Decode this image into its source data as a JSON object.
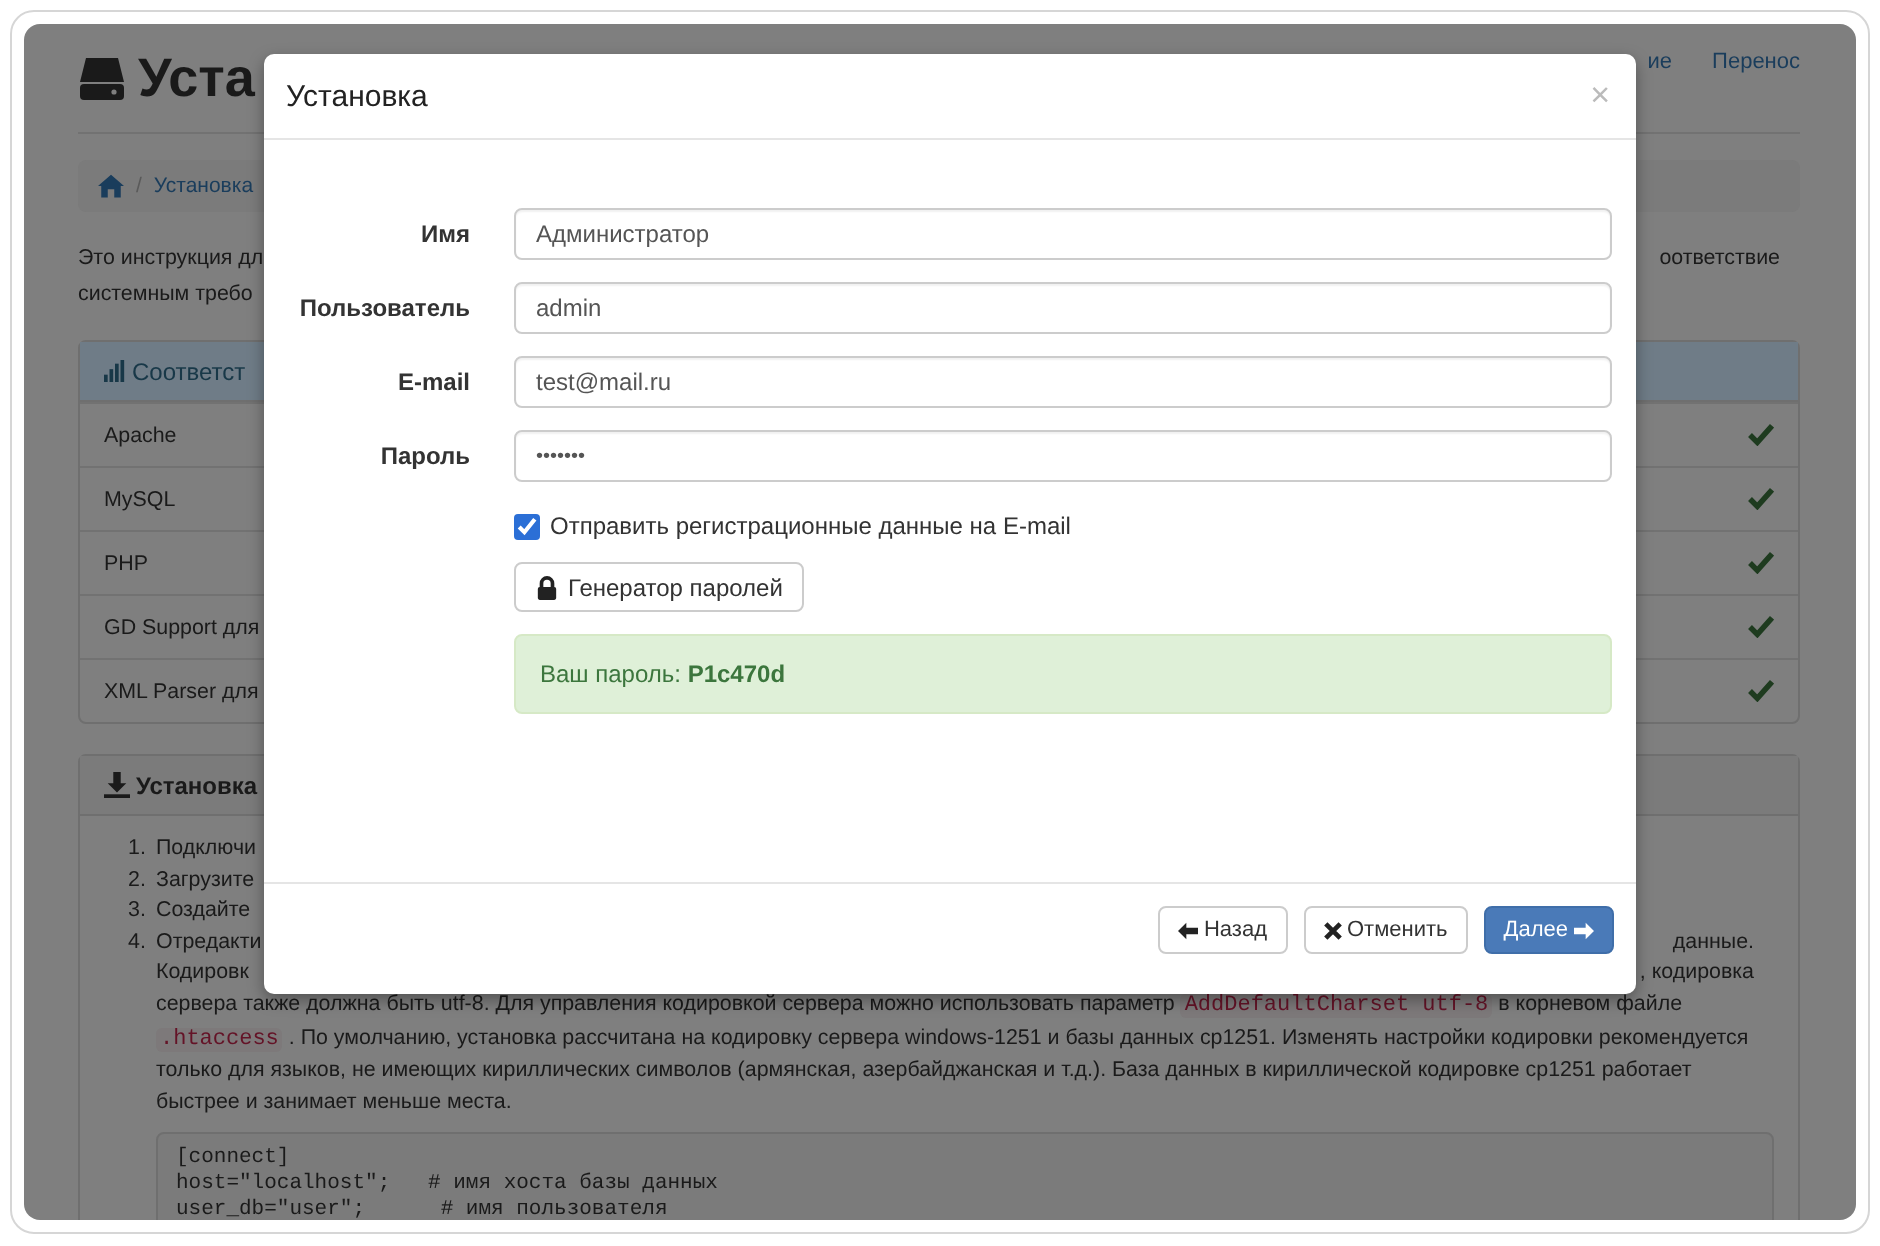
{
  "header": {
    "title": "Уста",
    "nav": [
      "ие",
      "Перенос"
    ]
  },
  "breadcrumb": {
    "separator": "/",
    "items": [
      "Установка"
    ]
  },
  "intro": {
    "lines": [
      {
        "left": "Это инструкция дл",
        "right": "оответствие"
      },
      {
        "left": "системным требо"
      }
    ]
  },
  "requirements": {
    "title": "Соответст",
    "rows": [
      {
        "name": "Apache",
        "ok": true
      },
      {
        "name": "MySQL",
        "ok": true
      },
      {
        "name": "PHP",
        "ok": true
      },
      {
        "name": "GD Support для",
        "ok": true
      },
      {
        "name": "XML Parser для",
        "ok": true
      }
    ]
  },
  "install": {
    "title": "Установка",
    "steps": [
      {
        "number": "1.",
        "left": "Подключи"
      },
      {
        "number": "2.",
        "left": "Загрузите"
      },
      {
        "number": "3.",
        "left": "Создайте"
      },
      {
        "number": "4.",
        "left": "Отредакти",
        "right": "данные."
      }
    ],
    "continuation": [
      {
        "left": "Кодировк",
        "right": ", кодировка"
      }
    ],
    "lines": [
      [
        {
          "kind": "text",
          "text": "сервера также должна быть utf-8. Для управления кодировкой сервера можно использовать параметр "
        },
        {
          "kind": "code",
          "text": "AddDefaultCharset utf-8"
        },
        {
          "kind": "text",
          "text": " в корневом файле"
        }
      ],
      [
        {
          "kind": "code",
          "text": ".htaccess"
        },
        {
          "kind": "text",
          "text": " . По умолчанию, установка рассчитана на кодировку сервера windows-1251 и базы данных cp1251. Изменять настройки кодировки рекомендуется"
        }
      ],
      [
        {
          "kind": "text",
          "text": "только для языков, не имеющих кириллических символов (армянская, азербайджанская и т.д.). База данных в кириллической кодировке cp1251 работает"
        }
      ],
      [
        {
          "kind": "text",
          "text": "быстрее и занимает меньше места."
        }
      ]
    ],
    "code": [
      "[connect]",
      "host=\"localhost\";   # имя хоста базы данных",
      "user_db=\"user\";      # имя пользователя"
    ]
  },
  "modal": {
    "title": "Установка",
    "close": "×",
    "fields": [
      {
        "label": "Имя",
        "value": "Администратор",
        "kind": "text"
      },
      {
        "label": "Пользователь",
        "value": "admin",
        "kind": "text"
      },
      {
        "label": "E-mail",
        "value": "test@mail.ru",
        "kind": "text"
      },
      {
        "label": "Пароль",
        "value": "•••••••",
        "kind": "password"
      }
    ],
    "send_email": {
      "label": "Отправить регистрационные данные на E-mail",
      "checked": true
    },
    "generator_button": "Генератор паролей",
    "alert": "Ваш пароль: **P1c470d**",
    "buttons": [
      {
        "label": "Назад",
        "kind": "back"
      },
      {
        "label": "Отменить",
        "kind": "cancel"
      },
      {
        "label": "Далее",
        "kind": "next"
      }
    ]
  }
}
